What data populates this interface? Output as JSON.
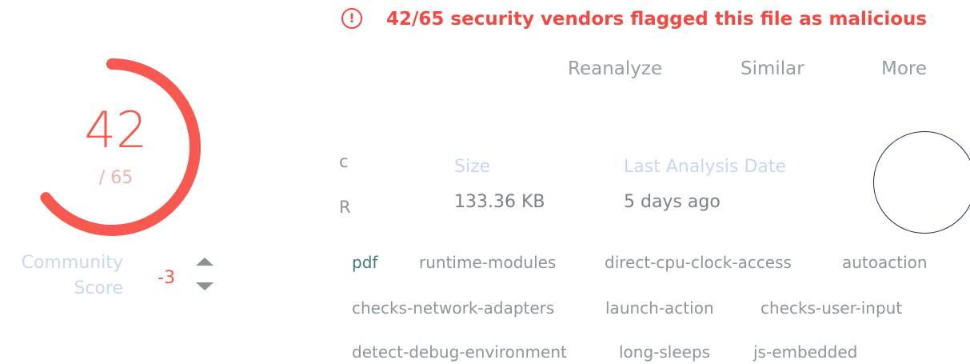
{
  "colors": {
    "malicious": "#f7584f",
    "alert": "#f24a43",
    "label_light": "#c9d6f3",
    "muted": "#8d959b",
    "tag_highlight": "#3f7a7a"
  },
  "score": {
    "detections": "42",
    "total_label": "/ 65",
    "detections_value": 42,
    "total_value": 65
  },
  "community": {
    "label_line1": "Community",
    "label_line2": "Score",
    "value": "-3"
  },
  "alert": {
    "icon": "exclamation-circle-icon",
    "text": "42/65 security vendors flagged this file as malicious"
  },
  "actions": {
    "reanalyze": "Reanalyze",
    "similar": "Similar",
    "more": "More"
  },
  "file": {
    "hash_line1": "c",
    "hash_line2": "R",
    "size_label": "Size",
    "size_value": "133.36 KB",
    "date_label": "Last Analysis Date",
    "date_value": "5 days ago"
  },
  "tags": [
    "pdf",
    "runtime-modules",
    "direct-cpu-clock-access",
    "autoaction",
    "checks-network-adapters",
    "launch-action",
    "checks-user-input",
    "detect-debug-environment",
    "long-sleeps",
    "js-embedded"
  ]
}
